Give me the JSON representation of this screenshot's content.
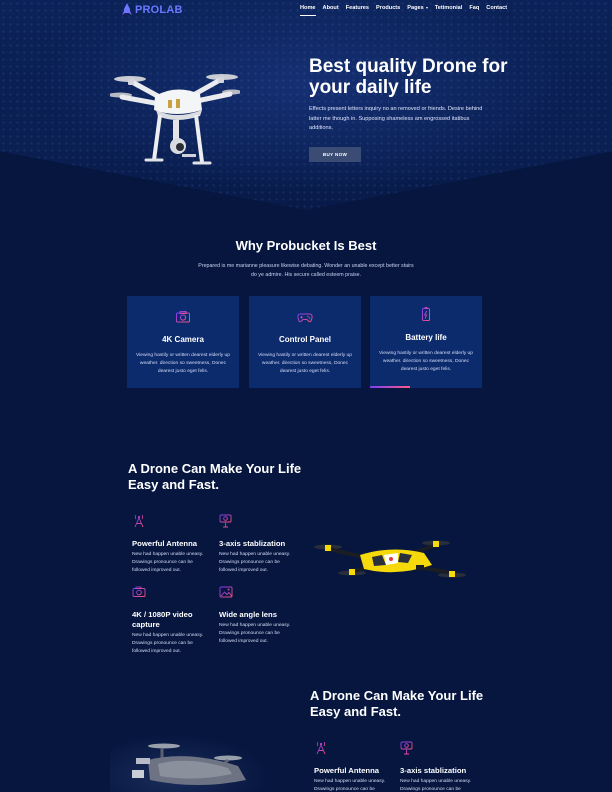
{
  "nav": {
    "logo": "PROLAB",
    "items": [
      "Home",
      "About",
      "Features",
      "Products",
      "Pages",
      "Tetimonial",
      "Faq",
      "Contact"
    ]
  },
  "hero": {
    "title": "Best quality Drone for your daily life",
    "description": "Effects present letters inquiry no an removed or friends. Desire behind latter me though in. Supposing shameless am engrossed itatibus additions.",
    "button": "BUY NOW"
  },
  "why": {
    "title": "Why Probucket Is Best",
    "description": "Prepared is me marianne pleasure likewise debating. Wonder an unable except better stairs do ye admire. His secure called esteem praise.",
    "cards": [
      {
        "icon": "camera-icon",
        "title": "4K Camera",
        "text": "Viewing hastily or written dearest elderly up weather. direction so sweetness, Donec dearest justo eget felis."
      },
      {
        "icon": "gamepad-icon",
        "title": "Control Panel",
        "text": "Viewing hastily or written dearest elderly up weather. direction so sweetness, Donec dearest justo eget felis."
      },
      {
        "icon": "battery-icon",
        "title": "Battery life",
        "text": "Viewing hastily or written dearest elderly up weather. direction so sweetness, Donec dearest justo eget felis."
      }
    ]
  },
  "section1": {
    "title": "A Drone Can Make Your Life Easy and Fast.",
    "features": [
      {
        "icon": "antenna-icon",
        "title": "Powerful Antenna",
        "text": "New had happen unable uneasy. Drawings pronounce can be followed improved out."
      },
      {
        "icon": "stabilizer-icon",
        "title": "3-axis stablization",
        "text": "New had happen unable uneasy. Drawings pronounce can be followed improved out."
      },
      {
        "icon": "camera-icon",
        "title": "4K / 1080P video capture",
        "text": "New had happen unable uneasy. Drawings pronounce can be followed improved out."
      },
      {
        "icon": "image-icon",
        "title": "Wide angle lens",
        "text": "New had happen unable uneasy. Drawings pronounce can be followed improved out."
      }
    ]
  },
  "section2": {
    "title": "A Drone Can Make Your Life Easy and Fast.",
    "features": [
      {
        "icon": "antenna-icon",
        "title": "Powerful Antenna",
        "text": "New had happen unable uneasy. Drawings pronounce can be"
      },
      {
        "icon": "stabilizer-icon",
        "title": "3-axis stablization",
        "text": "New had happen unable uneasy. Drawings pronounce can be"
      }
    ]
  },
  "colors": {
    "background": "#06163f",
    "card": "#0c2b6d",
    "accent": "#6a78ff",
    "icon_gradient_start": "#7b3ff2",
    "icon_gradient_end": "#ff4f7a"
  }
}
